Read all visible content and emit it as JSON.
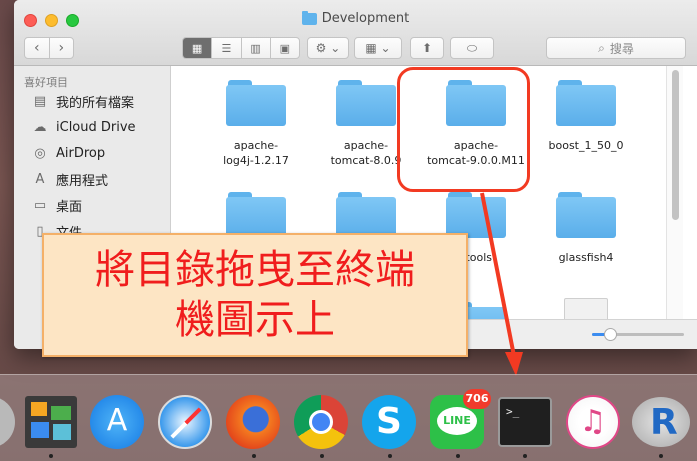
{
  "window": {
    "title": "Development"
  },
  "toolbar": {
    "back": "‹",
    "forward": "›",
    "view_icon": "▦",
    "view_list": "☰",
    "view_columns": "▥",
    "view_coverflow": "▣",
    "gear": "⚙ ⌄",
    "arrange": "▦ ⌄",
    "share": "⬆",
    "tag": "⬭",
    "search_placeholder": "搜尋"
  },
  "sidebar": {
    "heading": "喜好項目",
    "items": [
      {
        "label": "我的所有檔案",
        "icon": "▤"
      },
      {
        "label": "iCloud Drive",
        "icon": "☁"
      },
      {
        "label": "AirDrop",
        "icon": "◎"
      },
      {
        "label": "應用程式",
        "icon": "A"
      },
      {
        "label": "桌面",
        "icon": "▭"
      },
      {
        "label": "文件",
        "icon": "▯"
      }
    ]
  },
  "files": [
    {
      "line1": "apache-",
      "line2": "log4j-1.2.17"
    },
    {
      "line1": "apache-",
      "line2": "tomcat-8.0.9"
    },
    {
      "line1": "apache-",
      "line2": "tomcat-9.0.0.M11"
    },
    {
      "line1": "boost_1_50_0",
      "line2": ""
    },
    {
      "line1": "",
      "line2": ""
    },
    {
      "line1": "",
      "line2": ""
    },
    {
      "line1": "_tools",
      "line2": ""
    },
    {
      "line1": "glassfish4",
      "line2": ""
    }
  ],
  "annotation": {
    "line1": "將目錄拖曳至終端",
    "line2": "機圖示上",
    "color": "#f01d1d"
  },
  "dock": {
    "line_badge": "706",
    "line_label": "LINE",
    "terminal_prompt": ">_"
  },
  "icon_size_slider": {
    "value": 0.2
  }
}
